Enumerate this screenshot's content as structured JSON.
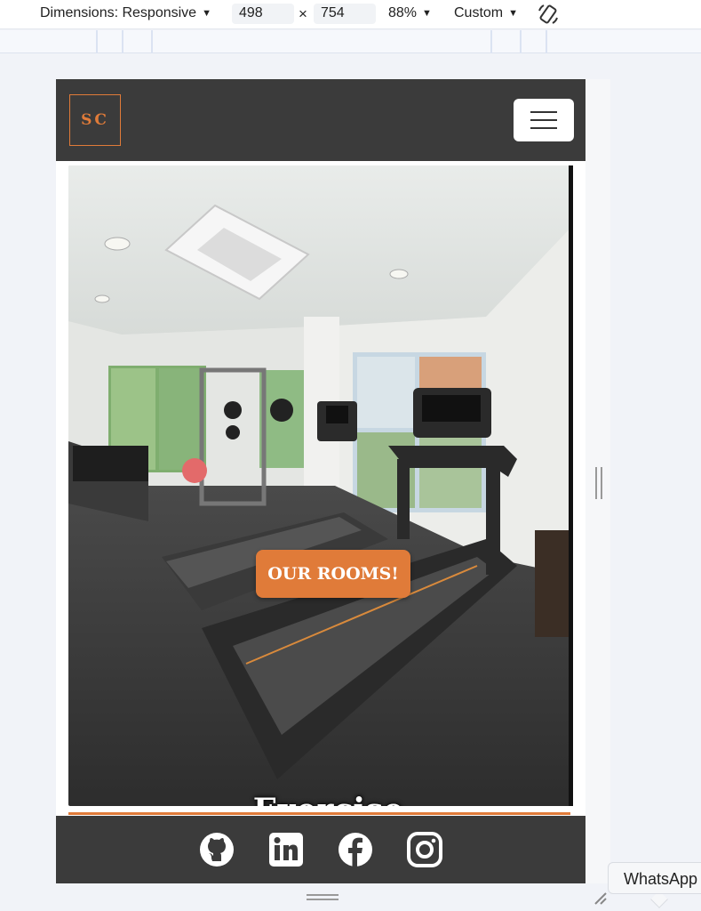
{
  "devtools": {
    "dimensions_label": "Dimensions: Responsive",
    "width_value": "498",
    "times_symbol": "×",
    "height_value": "754",
    "zoom": "88%",
    "throttle": "Custom",
    "rotate_icon": "rotate-icon"
  },
  "site": {
    "logo_text": "SC",
    "menu_icon": "hamburger-icon",
    "cta_label": "OUR ROOMS!",
    "room_title": "Exercise",
    "accent_color": "#e07b39",
    "nav_color": "#3b3b3b",
    "social_icons": [
      "github-icon",
      "linkedin-icon",
      "facebook-icon",
      "instagram-icon"
    ]
  },
  "tooltip": {
    "label": "WhatsApp"
  }
}
